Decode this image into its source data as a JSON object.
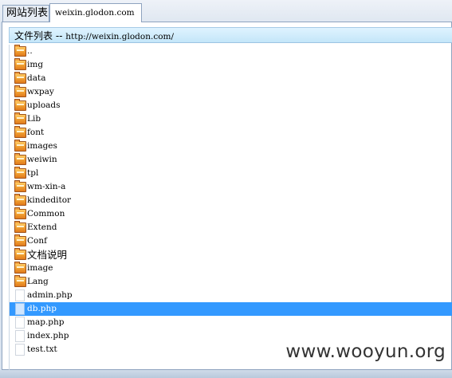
{
  "tabs": [
    {
      "label": "网站列表"
    },
    {
      "label": "weixin.glodon.com"
    }
  ],
  "panel": {
    "header_label": "文件列表 -- ",
    "header_url": "http://weixin.glodon.com/"
  },
  "files": [
    {
      "name": "..",
      "type": "folder",
      "icon": "folder-icon"
    },
    {
      "name": "img",
      "type": "folder",
      "icon": "folder-icon"
    },
    {
      "name": "data",
      "type": "folder",
      "icon": "folder-icon"
    },
    {
      "name": "wxpay",
      "type": "folder",
      "icon": "folder-icon"
    },
    {
      "name": "uploads",
      "type": "folder",
      "icon": "folder-icon"
    },
    {
      "name": "Lib",
      "type": "folder",
      "icon": "folder-icon"
    },
    {
      "name": "font",
      "type": "folder",
      "icon": "folder-icon"
    },
    {
      "name": "images",
      "type": "folder",
      "icon": "folder-icon"
    },
    {
      "name": "weiwin",
      "type": "folder",
      "icon": "folder-icon"
    },
    {
      "name": "tpl",
      "type": "folder",
      "icon": "folder-icon"
    },
    {
      "name": "wm-xin-a",
      "type": "folder",
      "icon": "folder-icon"
    },
    {
      "name": "kindeditor",
      "type": "folder",
      "icon": "folder-icon"
    },
    {
      "name": "Common",
      "type": "folder",
      "icon": "folder-icon"
    },
    {
      "name": "Extend",
      "type": "folder",
      "icon": "folder-icon"
    },
    {
      "name": "Conf",
      "type": "folder",
      "icon": "folder-icon"
    },
    {
      "name": "文档说明",
      "type": "folder",
      "icon": "folder-icon"
    },
    {
      "name": "image",
      "type": "folder",
      "icon": "folder-icon"
    },
    {
      "name": "Lang",
      "type": "folder",
      "icon": "folder-icon"
    },
    {
      "name": "admin.php",
      "type": "file",
      "icon": "file-icon"
    },
    {
      "name": "db.php",
      "type": "file",
      "icon": "file-icon",
      "selected": true
    },
    {
      "name": "map.php",
      "type": "file",
      "icon": "file-icon"
    },
    {
      "name": "index.php",
      "type": "file",
      "icon": "file-icon"
    },
    {
      "name": "test.txt",
      "type": "file",
      "icon": "file-icon"
    }
  ],
  "watermark": "www.wooyun.org",
  "colors": {
    "selection": "#3399ff",
    "header_bg": "#c4e6f9",
    "folder": "#f2a334"
  }
}
